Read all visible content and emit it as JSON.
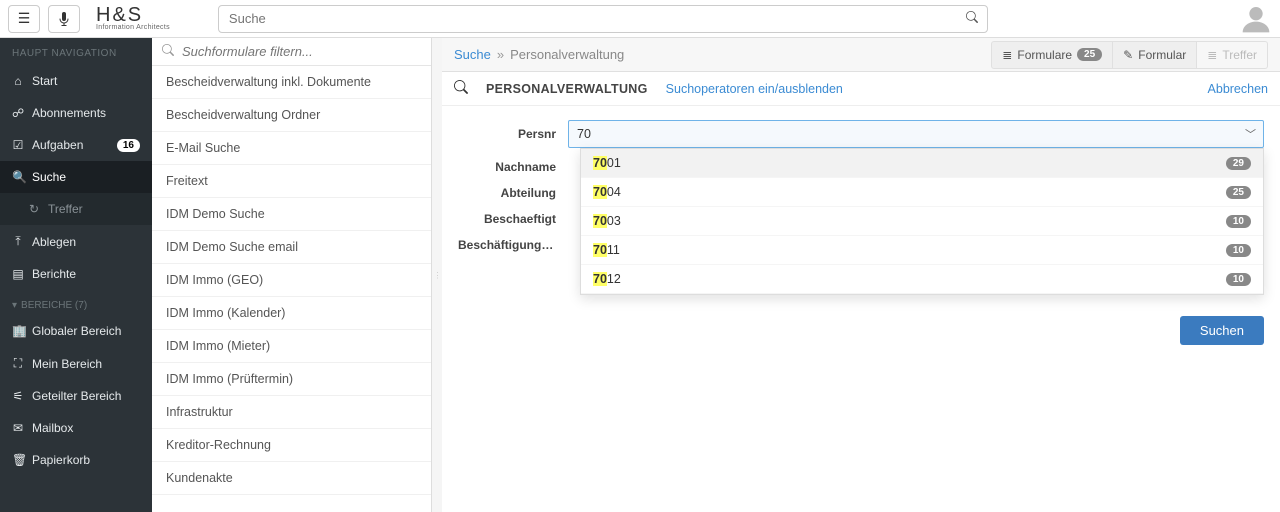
{
  "topbar": {
    "search_placeholder": "Suche",
    "logo_main": "H&S",
    "logo_sub": "Information Architects"
  },
  "sidenav": {
    "section_main": "Haupt Navigation",
    "start": "Start",
    "abonnements": "Abonnements",
    "aufgaben": "Aufgaben",
    "aufgaben_count": "16",
    "suche": "Suche",
    "treffer_sub": "Treffer",
    "ablegen": "Ablegen",
    "berichte": "Berichte",
    "bereiche_header": "Bereiche (7)",
    "globaler": "Globaler Bereich",
    "mein": "Mein Bereich",
    "geteilter": "Geteilter Bereich",
    "mailbox": "Mailbox",
    "papierkorb": "Papierkorb"
  },
  "midpanel": {
    "filter_placeholder": "Suchformulare filtern...",
    "items": [
      "Bescheidverwaltung inkl. Dokumente",
      "Bescheidverwaltung Ordner",
      "E-Mail Suche",
      "Freitext",
      "IDM Demo Suche",
      "IDM Demo Suche email",
      "IDM Immo (GEO)",
      "IDM Immo (Kalender)",
      "IDM Immo (Mieter)",
      "IDM Immo (Prüftermin)",
      "Infrastruktur",
      "Kreditor-Rechnung",
      "Kundenakte"
    ]
  },
  "breadcrumb": {
    "suche": "Suche",
    "current": "Personalverwaltung"
  },
  "toolbar": {
    "formulare": "Formulare",
    "formulare_count": "25",
    "formular": "Formular",
    "treffer": "Treffer"
  },
  "form": {
    "title": "Personalverwaltung",
    "operators_link": "Suchoperatoren ein/ausblenden",
    "cancel": "Abbrechen",
    "labels": {
      "persnr": "Persnr",
      "nachname": "Nachname",
      "abteilung": "Abteilung",
      "beschaeftigt": "Beschaeftigt",
      "beschaeftigung": "Beschäftigung__..."
    },
    "persnr_value": "70",
    "search_button": "Suchen"
  },
  "dropdown": {
    "match": "70",
    "items": [
      {
        "rest": "01",
        "count": "29"
      },
      {
        "rest": "04",
        "count": "25"
      },
      {
        "rest": "03",
        "count": "10"
      },
      {
        "rest": "11",
        "count": "10"
      },
      {
        "rest": "12",
        "count": "10"
      }
    ]
  }
}
